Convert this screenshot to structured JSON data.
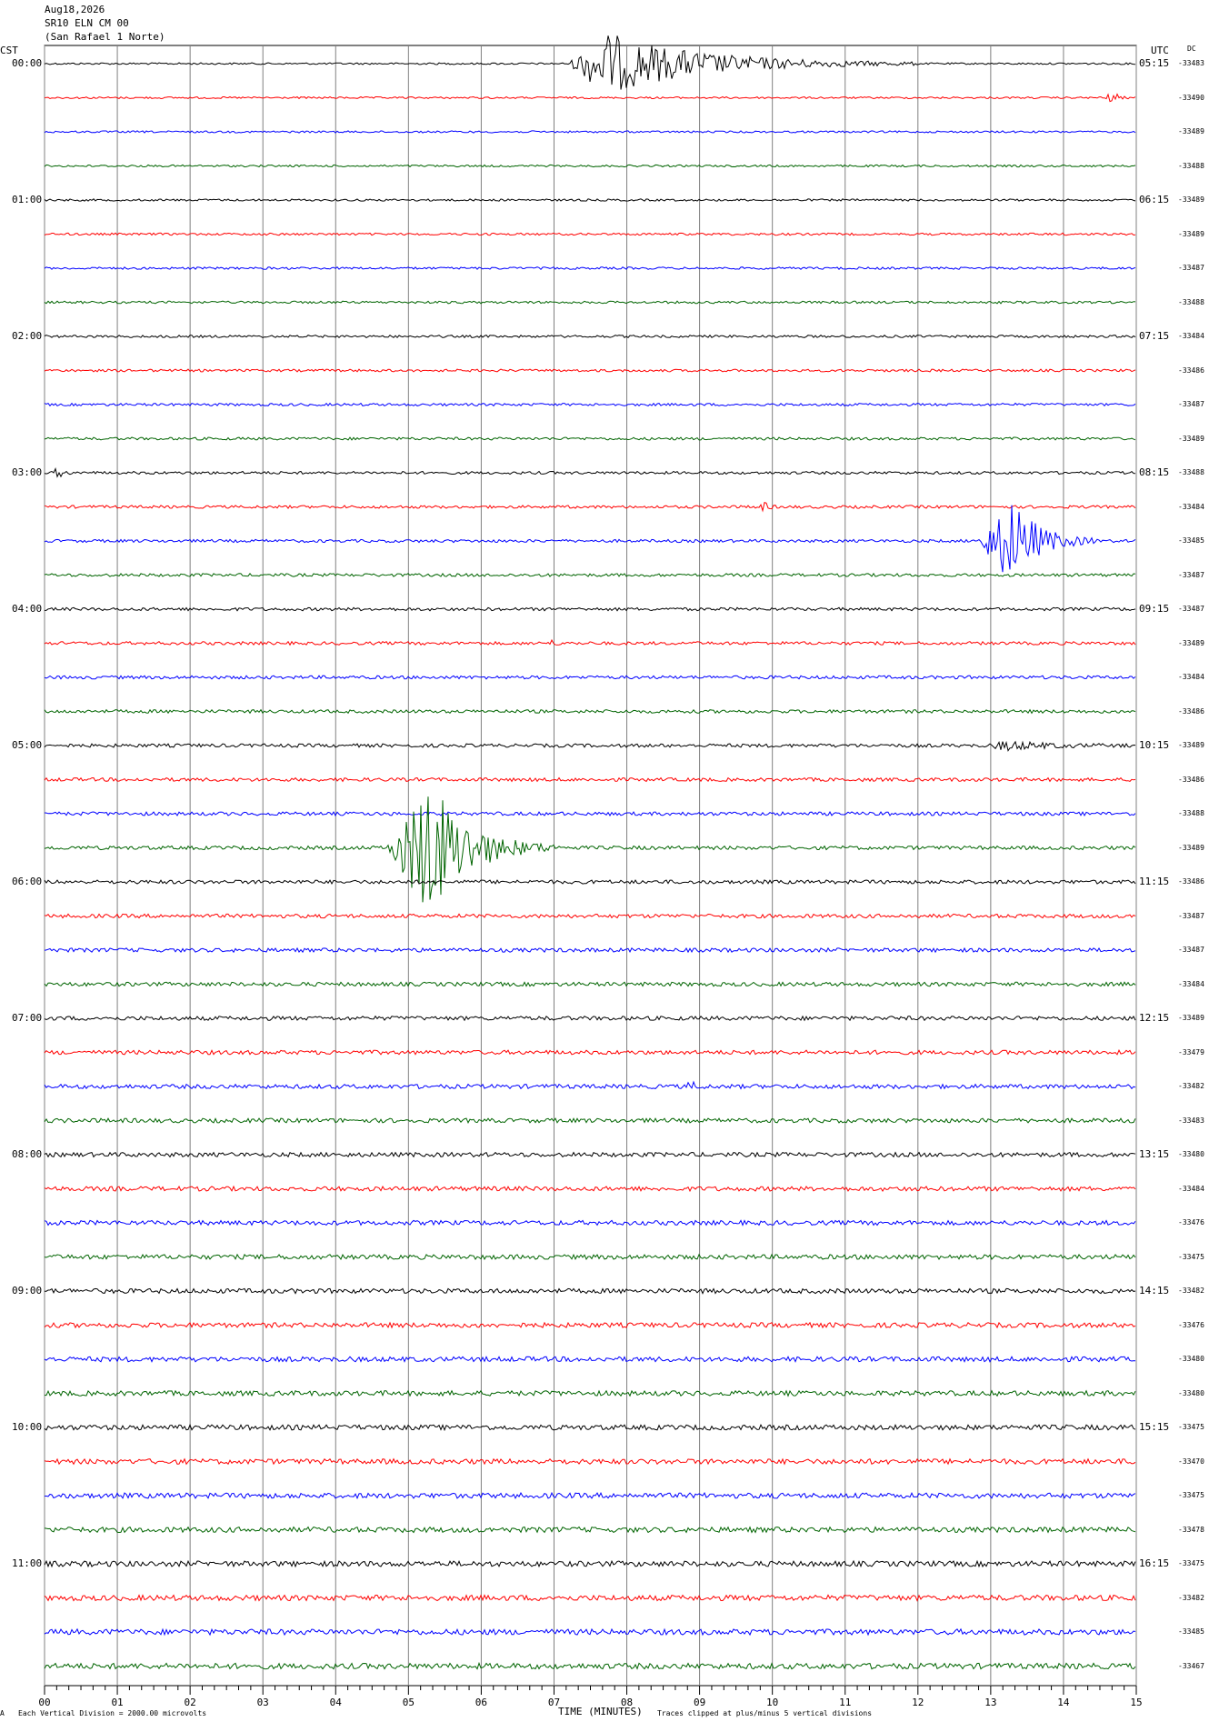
{
  "header": {
    "date": "Aug18,2026",
    "station": "SR10 ELN CM 00",
    "site": "(San Rafael 1 Norte)"
  },
  "labels": {
    "left_tz": "CST",
    "right_tz": "UTC",
    "dc": "DC",
    "xlabel": "TIME (MINUTES)",
    "scale_note": "Each Vertical Division = 2000.00 microvolts",
    "clip_note": "Traces clipped at plus/minus 5 vertical divisions",
    "corner_mark": "A"
  },
  "chart_data": {
    "type": "line",
    "xlim": [
      0,
      15
    ],
    "x_ticks": [
      "00",
      "01",
      "02",
      "03",
      "04",
      "05",
      "06",
      "07",
      "08",
      "09",
      "10",
      "11",
      "12",
      "13",
      "14",
      "15"
    ],
    "trace_colors": [
      "#000000",
      "#ff0000",
      "#0000ff",
      "#006400"
    ],
    "rows_per_hour": 4,
    "left_hour_labels": [
      "00:00",
      "01:00",
      "02:00",
      "03:00",
      "04:00",
      "05:00",
      "06:00",
      "07:00",
      "08:00",
      "09:00",
      "10:00",
      "11:00"
    ],
    "right_hour_labels": [
      "05:15",
      "06:15",
      "07:15",
      "08:15",
      "09:15",
      "10:15",
      "11:15",
      "12:15",
      "13:15",
      "14:15",
      "15:15",
      "16:15"
    ],
    "dc_offsets": [
      "-33483",
      "-33490",
      "-33489",
      "-33488",
      "-33489",
      "-33489",
      "-33487",
      "-33488",
      "-33484",
      "-33486",
      "-33487",
      "-33489",
      "-33488",
      "-33484",
      "-33485",
      "-33487",
      "-33487",
      "-33489",
      "-33484",
      "-33486",
      "-33489",
      "-33486",
      "-33488",
      "-33489",
      "-33486",
      "-33487",
      "-33487",
      "-33484",
      "-33489",
      "-33479",
      "-33482",
      "-33483",
      "-33480",
      "-33484",
      "-33476",
      "-33475",
      "-33482",
      "-33476",
      "-33480",
      "-33480",
      "-33475",
      "-33470",
      "-33475",
      "-33478",
      "-33475",
      "-33482",
      "-33485",
      "-33467"
    ],
    "events": [
      {
        "row": 0,
        "start_min": 7.2,
        "peak_min": 7.7,
        "end_min": 12.0,
        "amplitude_div": 0.9
      },
      {
        "row": 1,
        "start_min": 14.5,
        "peak_min": 14.7,
        "end_min": 14.9,
        "amplitude_div": 0.15
      },
      {
        "row": 12,
        "start_min": 0.1,
        "peak_min": 0.2,
        "end_min": 0.4,
        "amplitude_div": 0.15
      },
      {
        "row": 13,
        "start_min": 9.7,
        "peak_min": 9.9,
        "end_min": 10.1,
        "amplitude_div": 0.1
      },
      {
        "row": 14,
        "start_min": 12.8,
        "peak_min": 13.3,
        "end_min": 14.5,
        "amplitude_div": 1.2
      },
      {
        "row": 17,
        "start_min": 6.9,
        "peak_min": 7.0,
        "end_min": 7.1,
        "amplitude_div": 0.08
      },
      {
        "row": 20,
        "start_min": 13.0,
        "peak_min": 13.2,
        "end_min": 15.0,
        "amplitude_div": 0.12
      },
      {
        "row": 23,
        "start_min": 4.7,
        "peak_min": 5.3,
        "end_min": 7.0,
        "amplitude_div": 2.0
      },
      {
        "row": 30,
        "start_min": 8.8,
        "peak_min": 8.9,
        "end_min": 9.1,
        "amplitude_div": 0.12
      }
    ]
  }
}
